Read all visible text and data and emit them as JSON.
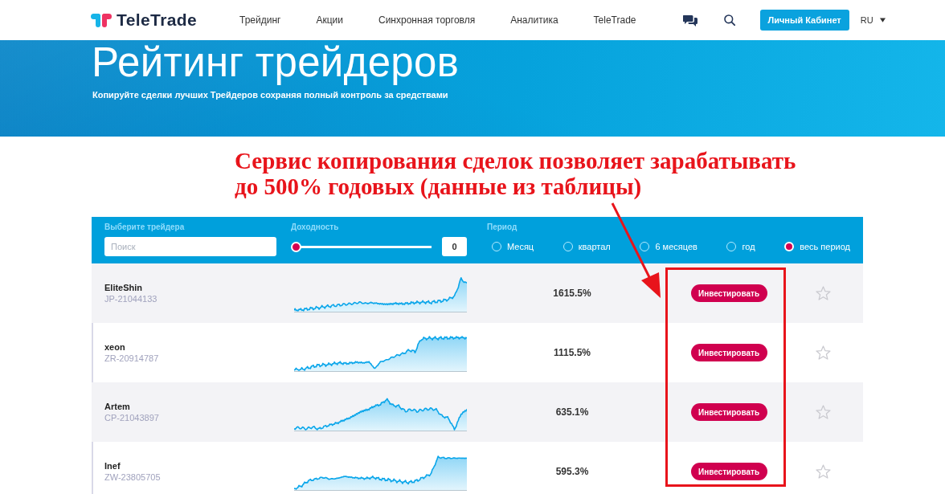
{
  "header": {
    "logo": "TeleTrade",
    "nav": [
      "Трейдинг",
      "Акции",
      "Синхронная торговля",
      "Аналитика",
      "TeleTrade"
    ],
    "account_button": "Личный Кабинет",
    "language": "RU"
  },
  "hero": {
    "title": "Рейтинг трейдеров",
    "subtitle": "Копируйте сделки лучших Трейдеров сохраняя полный контроль за средствами"
  },
  "annotation": {
    "lines": [
      "Сервис копирования сделок позволяет зарабатывать",
      "до 500% годовых (данные из таблицы)"
    ]
  },
  "filters": {
    "trader_label": "Выберите трейдера",
    "search_placeholder": "Поиск",
    "yield_label": "Доходность",
    "yield": {
      "level": 0,
      "value": "0"
    },
    "period_label": "Период",
    "periods": [
      {
        "label": "Месяц",
        "selected": false
      },
      {
        "label": "квартал",
        "selected": false
      },
      {
        "label": "6 месяцев",
        "selected": false
      },
      {
        "label": "год",
        "selected": false
      },
      {
        "label": "весь период",
        "selected": true
      }
    ]
  },
  "traders": [
    {
      "name": "EliteShin",
      "account": "JP-21044133",
      "return": "1615.5%",
      "button": "Инвестировать",
      "favorite": false
    },
    {
      "name": "xeon",
      "account": "ZR-20914787",
      "return": "1115.5%",
      "button": "Инвестировать",
      "favorite": false
    },
    {
      "name": "Artem",
      "account": "CP-21043897",
      "return": "635.1%",
      "button": "Инвестировать",
      "favorite": false
    },
    {
      "name": "Inef",
      "account": "ZW-23805705",
      "return": "595.3%",
      "button": "Инвестировать",
      "favorite": false
    }
  ]
}
